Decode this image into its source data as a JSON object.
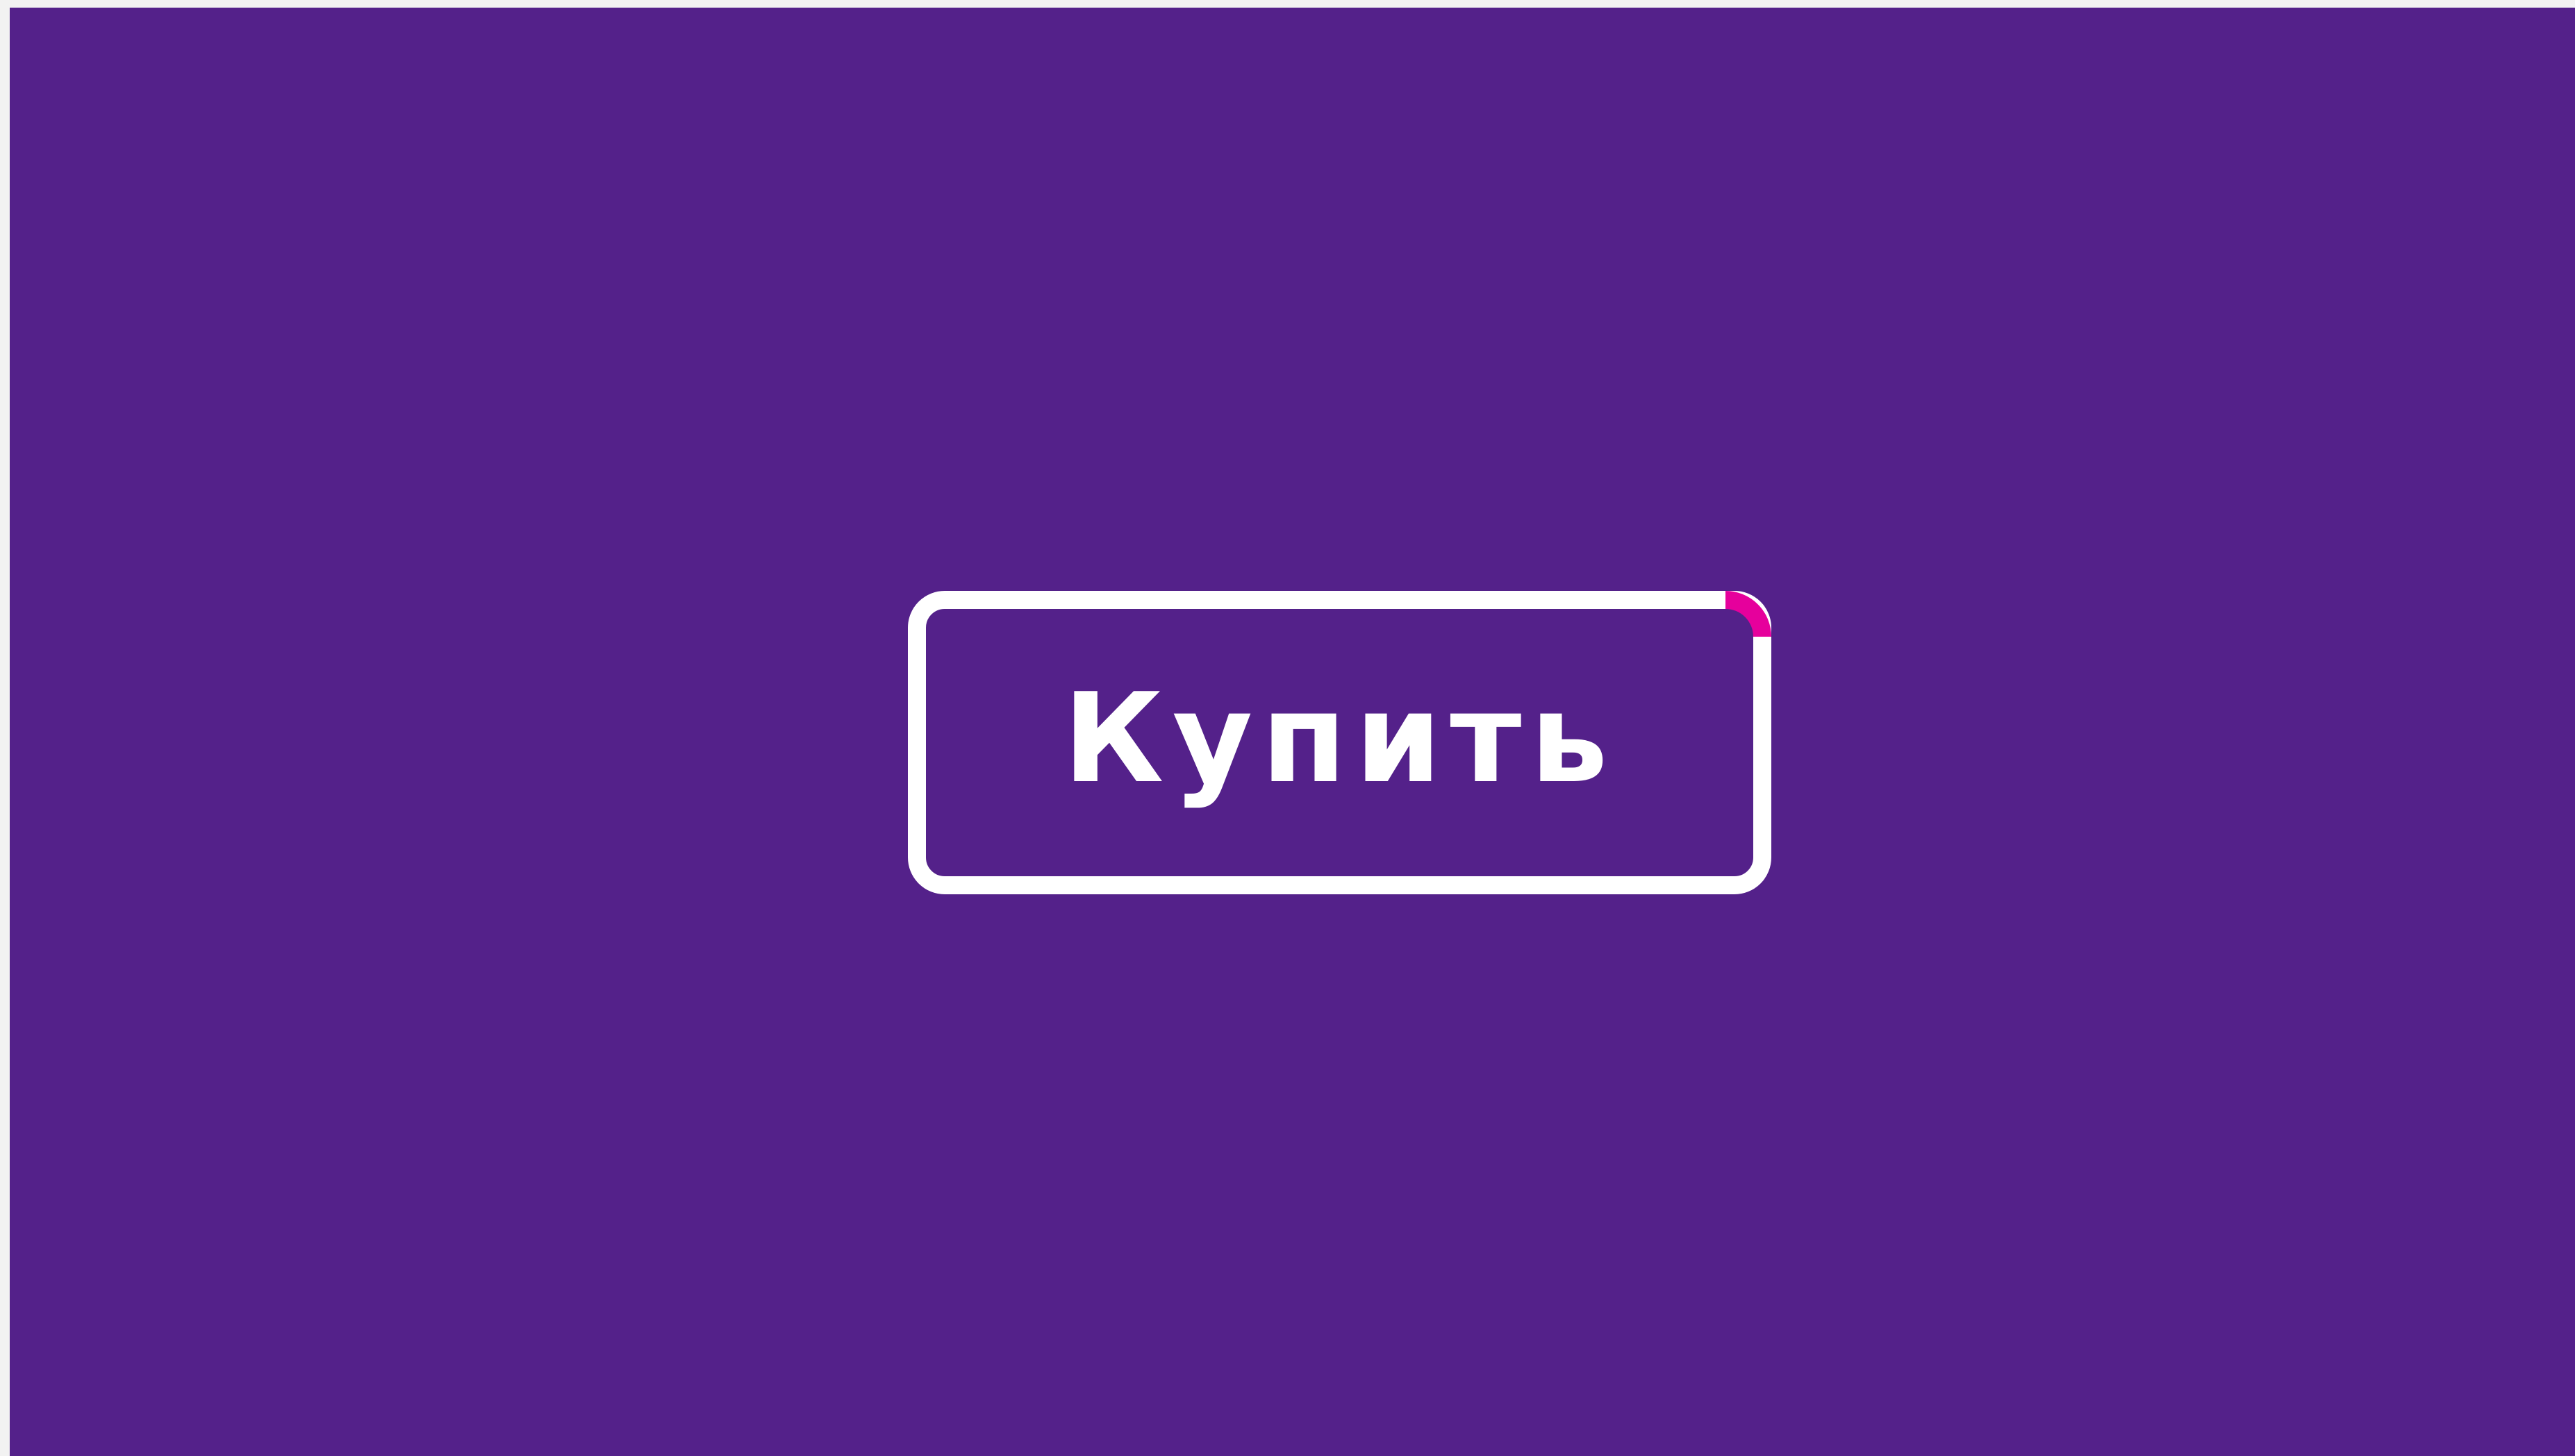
{
  "button": {
    "label": "Купить"
  },
  "colors": {
    "background": "#54218a",
    "page_edge": "#f2f2f2",
    "border": "#ffffff",
    "accent": "#e6009c",
    "text": "#ffffff"
  }
}
